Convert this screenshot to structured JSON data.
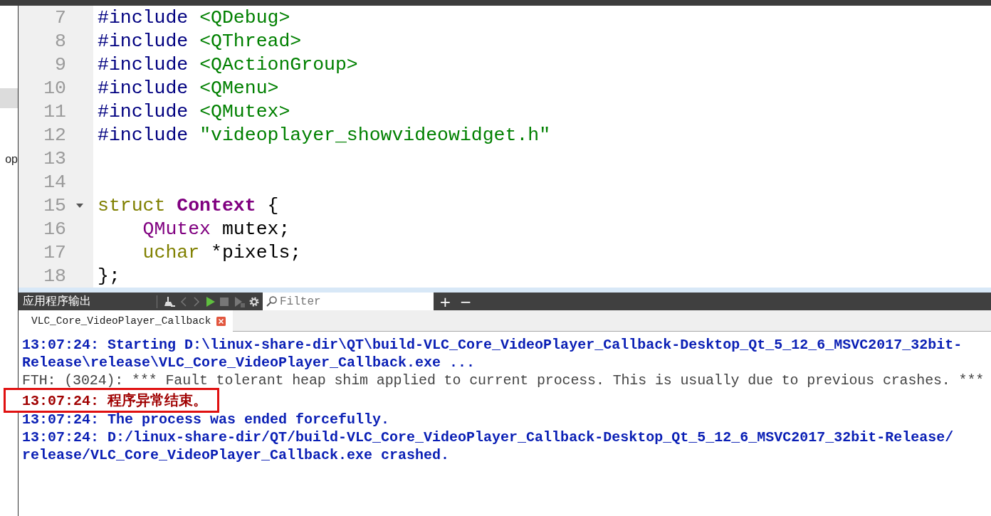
{
  "sidebar": {
    "items": [
      {
        "label": "op"
      }
    ]
  },
  "editor": {
    "lines": [
      {
        "number": "7",
        "foldable": false,
        "indented": false,
        "tokens": [
          {
            "text": "#include",
            "kind": "directive"
          },
          {
            "text": "<QDebug>",
            "kind": "string"
          }
        ]
      },
      {
        "number": "8",
        "foldable": false,
        "indented": false,
        "tokens": [
          {
            "text": "#include",
            "kind": "directive"
          },
          {
            "text": "<QThread>",
            "kind": "string"
          }
        ]
      },
      {
        "number": "9",
        "foldable": false,
        "indented": false,
        "tokens": [
          {
            "text": "#include",
            "kind": "directive"
          },
          {
            "text": "<QActionGroup>",
            "kind": "string"
          }
        ]
      },
      {
        "number": "10",
        "foldable": false,
        "indented": false,
        "tokens": [
          {
            "text": "#include",
            "kind": "directive"
          },
          {
            "text": "<QMenu>",
            "kind": "string"
          }
        ]
      },
      {
        "number": "11",
        "foldable": false,
        "indented": false,
        "tokens": [
          {
            "text": "#include",
            "kind": "directive"
          },
          {
            "text": "<QMutex>",
            "kind": "string"
          }
        ]
      },
      {
        "number": "12",
        "foldable": false,
        "indented": false,
        "tokens": [
          {
            "text": "#include",
            "kind": "directive"
          },
          {
            "text": "\"videoplayer_showvideowidget.h\"",
            "kind": "string"
          }
        ]
      },
      {
        "number": "13",
        "foldable": false
      },
      {
        "number": "14",
        "foldable": false
      },
      {
        "number": "15",
        "foldable": true,
        "indented": false,
        "tokens": [
          {
            "text": "struct",
            "kind": "keyword"
          },
          {
            "text": "Context",
            "kind": "type"
          },
          {
            "text": "{",
            "kind": "plain"
          }
        ]
      },
      {
        "number": "16",
        "foldable": false,
        "indented": true,
        "tokens": [
          {
            "text": "QMutex",
            "kind": "class"
          },
          {
            "text": "mutex;",
            "kind": "plain"
          }
        ]
      },
      {
        "number": "17",
        "foldable": false,
        "indented": true,
        "tokens": [
          {
            "text": "uchar",
            "kind": "keyword"
          },
          {
            "text": "*pixels;",
            "kind": "plain"
          }
        ]
      },
      {
        "number": "18",
        "foldable": false,
        "indented": false,
        "tokens": [
          {
            "text": "};",
            "kind": "plain"
          }
        ]
      }
    ]
  },
  "output": {
    "title": "应用程序输出",
    "filter": {
      "placeholder": "Filter"
    },
    "add": "+",
    "remove": "−",
    "tabs": [
      {
        "label": "VLC_Core_VideoPlayer_Callback",
        "selected": true
      }
    ],
    "lines": [
      {
        "text": "13:07:24: Starting D:\\linux-share-dir\\QT\\build-VLC_Core_VideoPlayer_Callback-Desktop_Qt_5_12_6_MSVC2017_32bit-",
        "kind": "info",
        "highlighted": false
      },
      {
        "text": "Release\\release\\VLC_Core_VideoPlayer_Callback.exe ...",
        "kind": "info",
        "highlighted": false
      },
      {
        "text": "FTH: (3024): *** Fault tolerant heap shim applied to current process. This is usually due to previous crashes. ***",
        "kind": "plain",
        "highlighted": false
      },
      {
        "text": "13:07:24: 程序异常结束。",
        "kind": "error",
        "highlighted": true
      },
      {
        "text": "13:07:24: The process was ended forcefully.",
        "kind": "info",
        "highlighted": false
      },
      {
        "text": "13:07:24: D:/linux-share-dir/QT/build-VLC_Core_VideoPlayer_Callback-Desktop_Qt_5_12_6_MSVC2017_32bit-Release/",
        "kind": "info",
        "highlighted": false
      },
      {
        "text": "release/VLC_Core_VideoPlayer_Callback.exe crashed.",
        "kind": "info",
        "highlighted": false
      }
    ]
  }
}
